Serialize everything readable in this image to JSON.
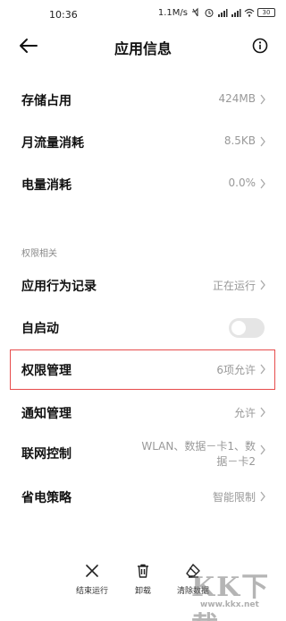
{
  "status_bar": {
    "time": "10:36",
    "network_speed": "1.1M/s",
    "battery": "30"
  },
  "header": {
    "title": "应用信息"
  },
  "rows": {
    "storage": {
      "label": "存储占用",
      "value": "424MB"
    },
    "traffic": {
      "label": "月流量消耗",
      "value": "8.5KB"
    },
    "power": {
      "label": "电量消耗",
      "value": "0.0%"
    }
  },
  "section": {
    "label": "权限相关"
  },
  "permission_rows": {
    "behavior": {
      "label": "应用行为记录",
      "value": "正在运行"
    },
    "autostart": {
      "label": "自启动",
      "toggle_on": false
    },
    "permissions": {
      "label": "权限管理",
      "value": "6项允许"
    },
    "notifications": {
      "label": "通知管理",
      "value": "允许"
    },
    "network": {
      "label": "联网控制",
      "value_line1": "WLAN、数据－卡1、数",
      "value_line2": "据－卡2"
    },
    "battery_saver": {
      "label": "省电策略",
      "value": "智能限制"
    }
  },
  "bottom_bar": {
    "force_stop": "结束运行",
    "uninstall": "卸载",
    "clear_data": "清除数据"
  },
  "watermark": {
    "text": "KK下载",
    "url": "www.kkx.net"
  },
  "colors": {
    "highlight_border": "#e74c4c",
    "secondary_text": "#999999"
  }
}
